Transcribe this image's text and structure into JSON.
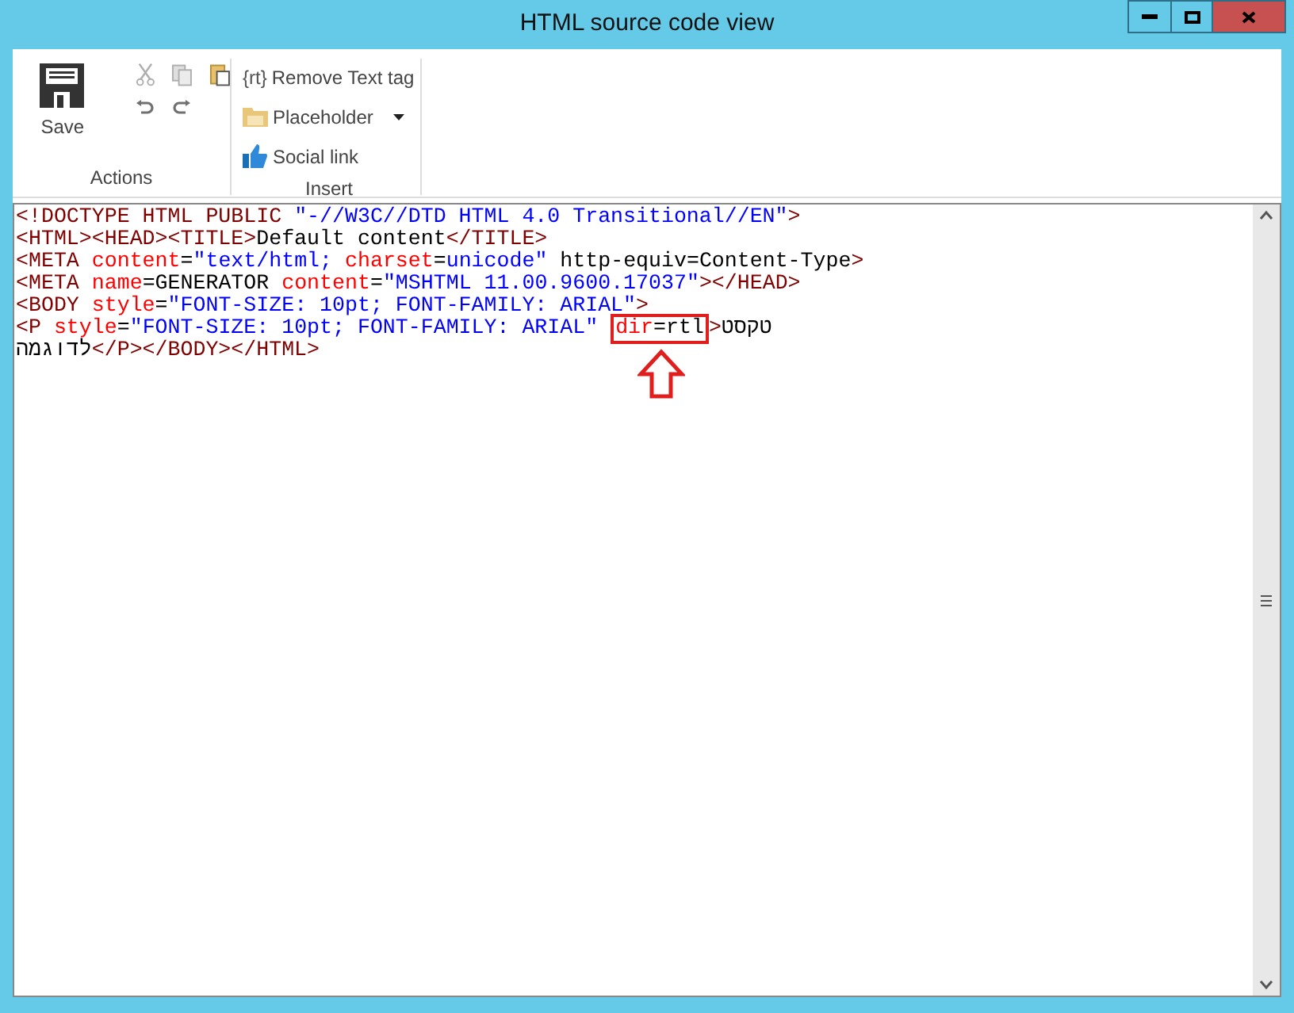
{
  "window": {
    "title": "HTML source code view"
  },
  "ribbon": {
    "groups": [
      {
        "label": "Actions",
        "save": {
          "label": "Save"
        },
        "tools": [
          {
            "kind": "cut",
            "disabled": true
          },
          {
            "kind": "copy",
            "disabled": true
          },
          {
            "kind": "paste",
            "disabled": false
          },
          {
            "kind": "undo",
            "disabled": false
          },
          {
            "kind": "redo",
            "disabled": false
          }
        ]
      },
      {
        "label": "Insert",
        "items": [
          {
            "kind": "tag",
            "icon_text": "{rt}",
            "label": "Remove Text tag"
          },
          {
            "kind": "dropdown",
            "label": "Placeholder"
          },
          {
            "kind": "like",
            "label": "Social link"
          }
        ]
      }
    ]
  },
  "editor": {
    "lines": [
      [
        {
          "kind": "tag",
          "text": "<!DOCTYPE HTML PUBLIC "
        },
        {
          "kind": "value",
          "text": "\"-//W3C//DTD HTML 4.0 Transitional//EN\""
        },
        {
          "kind": "tag",
          "text": ">"
        }
      ],
      [
        {
          "kind": "tag",
          "text": "<HTML><HEAD><TITLE>"
        },
        {
          "kind": "plain",
          "text": "Default content"
        },
        {
          "kind": "tag",
          "text": "</TITLE>"
        }
      ],
      [
        {
          "kind": "tag",
          "text": "<META "
        },
        {
          "kind": "attr",
          "text": "content"
        },
        {
          "kind": "plain",
          "text": "="
        },
        {
          "kind": "value",
          "text": "\"text/html; "
        },
        {
          "kind": "attr",
          "text": "charset"
        },
        {
          "kind": "plain",
          "text": "="
        },
        {
          "kind": "value",
          "text": "unicode\""
        },
        {
          "kind": "plain",
          "text": " http-equiv=Content-Type"
        },
        {
          "kind": "tag",
          "text": ">"
        }
      ],
      [
        {
          "kind": "tag",
          "text": "<META "
        },
        {
          "kind": "attr",
          "text": "name"
        },
        {
          "kind": "plain",
          "text": "=GENERATOR "
        },
        {
          "kind": "attr",
          "text": "content"
        },
        {
          "kind": "plain",
          "text": "="
        },
        {
          "kind": "value",
          "text": "\"MSHTML 11.00.9600.17037\""
        },
        {
          "kind": "tag",
          "text": "></HEAD>"
        }
      ],
      [
        {
          "kind": "tag",
          "text": "<BODY "
        },
        {
          "kind": "attr",
          "text": "style"
        },
        {
          "kind": "plain",
          "text": "="
        },
        {
          "kind": "value",
          "text": "\"FONT-SIZE: 10pt; FONT-FAMILY: ARIAL\""
        },
        {
          "kind": "tag",
          "text": ">"
        }
      ],
      [
        {
          "kind": "tag",
          "text": "<P "
        },
        {
          "kind": "attr",
          "text": "style"
        },
        {
          "kind": "plain",
          "text": "="
        },
        {
          "kind": "value",
          "text": "\"FONT-SIZE: 10pt; FONT-FAMILY: ARIAL\" "
        },
        {
          "kind": "highlight",
          "tokens": [
            {
              "kind": "attr",
              "text": "dir"
            },
            {
              "kind": "plain",
              "text": "=rtl"
            }
          ]
        },
        {
          "kind": "tag",
          "text": ">"
        },
        {
          "kind": "plain",
          "text": "טקסט"
        }
      ],
      [
        {
          "kind": "plain",
          "text": "לדוגמה"
        },
        {
          "kind": "tag",
          "text": "</P></BODY></HTML>"
        }
      ]
    ]
  }
}
